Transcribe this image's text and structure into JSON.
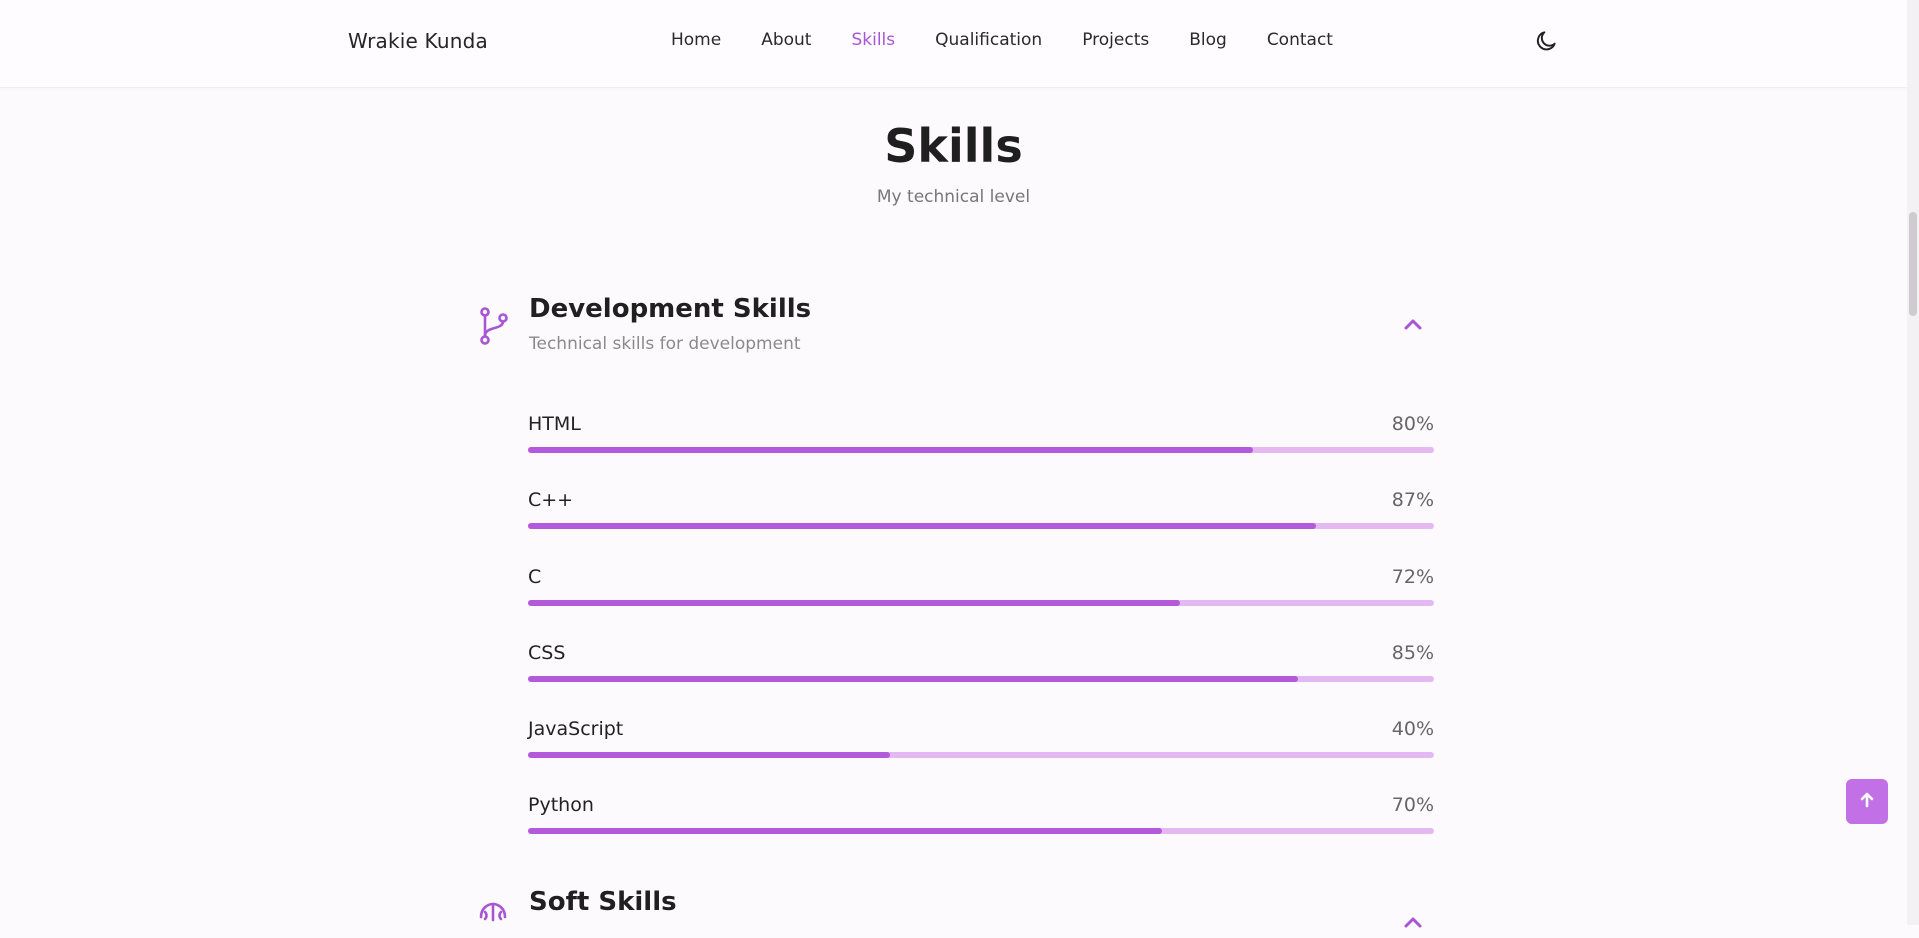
{
  "header": {
    "brand": "Wrakie Kunda",
    "nav": [
      "Home",
      "About",
      "Skills",
      "Qualification",
      "Projects",
      "Blog",
      "Contact"
    ],
    "active_nav": "Skills"
  },
  "section": {
    "title": "Skills",
    "subtitle": "My technical level"
  },
  "groups": [
    {
      "title": "Development Skills",
      "subtitle": "Technical skills for development",
      "icon": "branch-icon",
      "expanded": true,
      "skills": [
        {
          "name": "HTML",
          "percent_label": "80%",
          "value": 80
        },
        {
          "name": "C++",
          "percent_label": "87%",
          "value": 87
        },
        {
          "name": "C",
          "percent_label": "72%",
          "value": 72
        },
        {
          "name": "CSS",
          "percent_label": "85%",
          "value": 85
        },
        {
          "name": "JavaScript",
          "percent_label": "40%",
          "value": 40
        },
        {
          "name": "Python",
          "percent_label": "70%",
          "value": 70
        }
      ]
    },
    {
      "title": "Soft Skills",
      "icon": "brain-icon"
    }
  ],
  "colors": {
    "accent": "#b25ad9",
    "track": "#e4b9f2",
    "active_nav": "#a855d6",
    "scrollup_bg": "#c270e6"
  },
  "icons": {
    "theme_toggle": "moon-icon",
    "scroll_up": "arrow-up-icon",
    "collapse": "chevron-up-icon"
  }
}
